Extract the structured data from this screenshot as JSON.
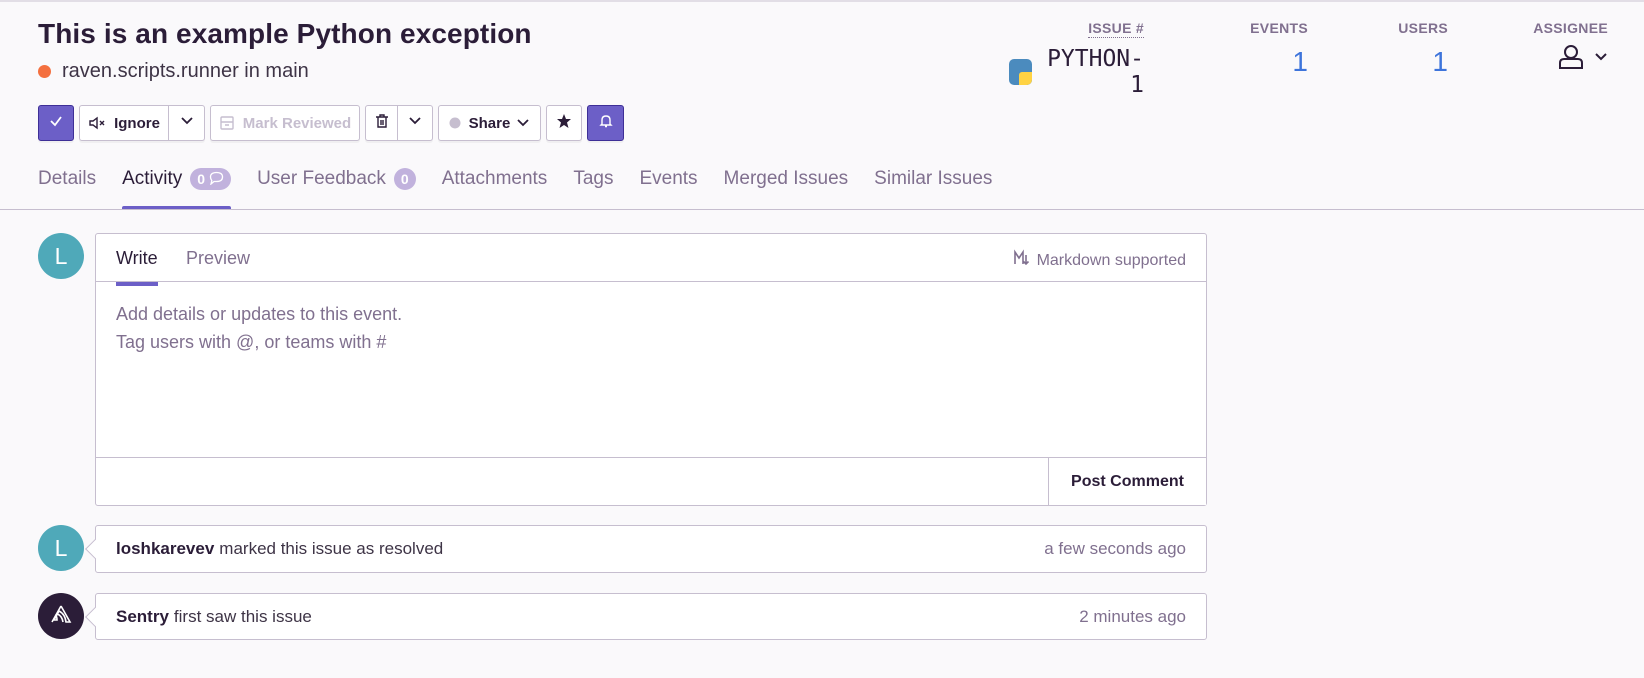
{
  "issue": {
    "title": "This is an example Python exception",
    "culprit": "raven.scripts.runner in main"
  },
  "stats": {
    "issue_label": "ISSUE #",
    "issue_id": "PYTHON-1",
    "events_label": "EVENTS",
    "events_value": "1",
    "users_label": "USERS",
    "users_value": "1",
    "assignee_label": "ASSIGNEE"
  },
  "toolbar": {
    "ignore_label": "Ignore",
    "mark_reviewed_label": "Mark Reviewed",
    "share_label": "Share"
  },
  "tabs": [
    {
      "label": "Details"
    },
    {
      "label": "Activity",
      "badge": "0"
    },
    {
      "label": "User Feedback",
      "badge": "0"
    },
    {
      "label": "Attachments"
    },
    {
      "label": "Tags"
    },
    {
      "label": "Events"
    },
    {
      "label": "Merged Issues"
    },
    {
      "label": "Similar Issues"
    }
  ],
  "editor": {
    "avatar_letter": "L",
    "write_tab": "Write",
    "preview_tab": "Preview",
    "markdown_label": "Markdown supported",
    "placeholder": "Add details or updates to this event.\nTag users with @, or teams with #",
    "post_label": "Post Comment"
  },
  "activity": [
    {
      "avatar": "L",
      "who": "loshkarevev",
      "what": "marked this issue as resolved",
      "when": "a few seconds ago"
    },
    {
      "who": "Sentry",
      "what": "first saw this issue",
      "when": "2 minutes ago"
    }
  ],
  "colors": {
    "accent": "#6c5fc7",
    "link": "#3d74db",
    "status_dot": "#f4703f",
    "avatar_teal": "#4fa9b9"
  }
}
